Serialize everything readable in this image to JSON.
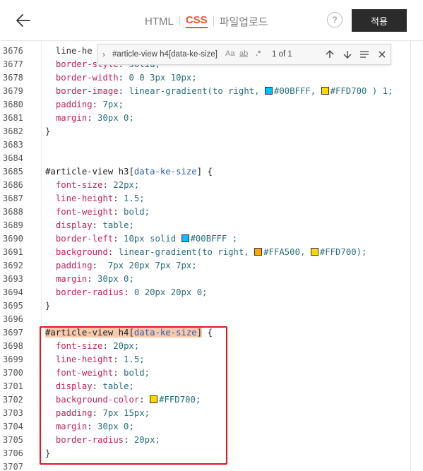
{
  "toolbar": {
    "tabs": [
      "HTML",
      "CSS",
      "파일업로드"
    ],
    "active_tab": "CSS",
    "help_label": "?",
    "apply_label": "적용"
  },
  "find": {
    "query": "#article-view h4[data-ke-size]",
    "match_case": "Aa",
    "whole_word": "ab",
    "regex": ".*",
    "count": "1 of 1"
  },
  "colors": {
    "accent_tab": "#e8542a",
    "highlight_box": "#e6131b",
    "swatch_blue": "#00BFFF",
    "swatch_gold": "#FFD700",
    "swatch_orange": "#FFA500"
  },
  "editor": {
    "lines": [
      {
        "num": "3676",
        "text": "  line-he"
      },
      {
        "num": "3677",
        "text": "  border-style: solid;"
      },
      {
        "num": "3678",
        "text": "  border-width: 0 0 3px 10px;"
      },
      {
        "num": "3679",
        "text": "  border-image: linear-gradient(to right, #00BFFF, #FFD700 ) 1;"
      },
      {
        "num": "3680",
        "text": "  padding: 7px;"
      },
      {
        "num": "3681",
        "text": "  margin: 30px 0;"
      },
      {
        "num": "3682",
        "text": "}"
      },
      {
        "num": "3683",
        "text": ""
      },
      {
        "num": "3684",
        "text": ""
      },
      {
        "num": "3685",
        "text": "#article-view h3[data-ke-size] {"
      },
      {
        "num": "3686",
        "text": "  font-size: 22px;"
      },
      {
        "num": "3687",
        "text": "  line-height: 1.5;"
      },
      {
        "num": "3688",
        "text": "  font-weight: bold;"
      },
      {
        "num": "3689",
        "text": "  display: table;"
      },
      {
        "num": "3690",
        "text": "  border-left: 10px solid #00BFFF ;"
      },
      {
        "num": "3691",
        "text": "  background: linear-gradient(to right, #FFA500, #FFD700);"
      },
      {
        "num": "3692",
        "text": "  padding:  7px 20px 7px 7px;"
      },
      {
        "num": "3693",
        "text": "  margin: 30px 0;"
      },
      {
        "num": "3694",
        "text": "  border-radius: 0 20px 20px 0;"
      },
      {
        "num": "3695",
        "text": "}"
      },
      {
        "num": "3696",
        "text": ""
      },
      {
        "num": "3697",
        "text": "#article-view h4[data-ke-size] {"
      },
      {
        "num": "3698",
        "text": "  font-size: 20px;"
      },
      {
        "num": "3699",
        "text": "  line-height: 1.5;"
      },
      {
        "num": "3700",
        "text": "  font-weight: bold;"
      },
      {
        "num": "3701",
        "text": "  display: table;"
      },
      {
        "num": "3702",
        "text": "  background-color: #FFD700;"
      },
      {
        "num": "3703",
        "text": "  padding: 7px 15px;"
      },
      {
        "num": "3704",
        "text": "  margin: 30px 0;"
      },
      {
        "num": "3705",
        "text": "  border-radius: 20px;"
      },
      {
        "num": "3706",
        "text": "}"
      },
      {
        "num": "3707",
        "text": ""
      }
    ]
  }
}
